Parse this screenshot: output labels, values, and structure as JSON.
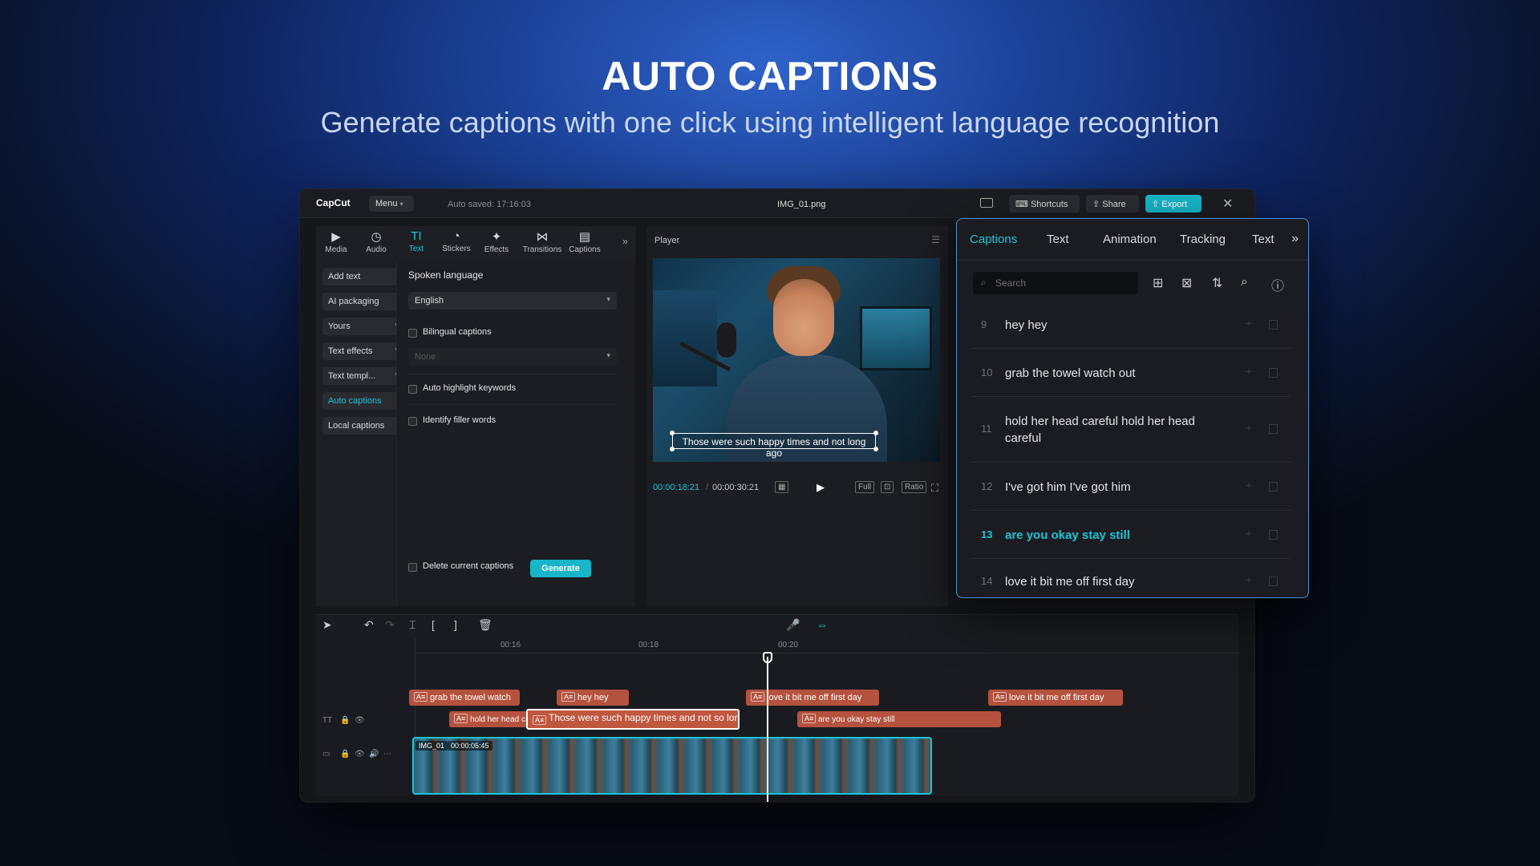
{
  "hero": {
    "title": "AUTO CAPTIONS",
    "subtitle": "Generate captions with one click using intelligent language recognition"
  },
  "titlebar": {
    "logo": "CapCut",
    "menu": "Menu",
    "autosave": "Auto saved: 17:16:03",
    "filename": "IMG_01.png",
    "shortcuts": "Shortcuts",
    "share": "Share",
    "export": "Export"
  },
  "toolbar": {
    "tools": [
      {
        "label": "Media",
        "icon": "▶"
      },
      {
        "label": "Audio",
        "icon": "◷"
      },
      {
        "label": "Text",
        "icon": "TI"
      },
      {
        "label": "Stickers",
        "icon": "◔"
      },
      {
        "label": "Effects",
        "icon": "✦"
      },
      {
        "label": "Transitions",
        "icon": "⋈"
      },
      {
        "label": "Captions",
        "icon": "▤"
      }
    ],
    "more": "»"
  },
  "sidebar": {
    "items": [
      {
        "label": "Add text"
      },
      {
        "label": "AI packaging"
      },
      {
        "label": "Yours"
      },
      {
        "label": "Text effects"
      },
      {
        "label": "Text templ..."
      },
      {
        "label": "Auto captions"
      },
      {
        "label": "Local captions"
      }
    ]
  },
  "auto_captions_panel": {
    "spoken_language_label": "Spoken language",
    "spoken_language_value": "English",
    "bilingual_label": "Bilingual captions",
    "bilingual_value": "None",
    "highlight_label": "Auto highlight keywords",
    "filler_label": "Identify filler words",
    "delete_label": "Delete current captions",
    "generate": "Generate"
  },
  "player": {
    "label": "Player",
    "subtitle": "Those were such happy times and not long ago",
    "current_time": "00:00:18:21",
    "total_time": "00:00:30:21",
    "full": "Full",
    "ratio": "Ratio"
  },
  "captions_panel": {
    "tabs": [
      "Captions",
      "Text",
      "Animation",
      "Tracking",
      "Text"
    ],
    "active_tab": "Captions",
    "search_placeholder": "Search",
    "rows": [
      {
        "num": "9",
        "text": "hey hey"
      },
      {
        "num": "10",
        "text": "grab the towel watch out"
      },
      {
        "num": "11",
        "text": "hold her head careful hold her head careful"
      },
      {
        "num": "12",
        "text": "I've got him I've got him"
      },
      {
        "num": "13",
        "text": "are you okay stay still"
      },
      {
        "num": "14",
        "text": "love it bit me off first day"
      }
    ],
    "active_row": "13"
  },
  "timeline": {
    "ticks": [
      "00:16",
      "00:18",
      "00:20"
    ],
    "clips_row1": [
      {
        "text": "grab the towel watch"
      },
      {
        "text": "hey hey"
      },
      {
        "text": "love it bit me off first day"
      },
      {
        "text": "love it bit me off first day"
      }
    ],
    "clips_row2": [
      {
        "text": "hold her head caref"
      },
      {
        "text": "Those were such happy times and not so long ago"
      },
      {
        "text": "are you okay stay still"
      }
    ],
    "video_clip_name": "IMG_01",
    "video_clip_duration": "00:00:05:45"
  }
}
